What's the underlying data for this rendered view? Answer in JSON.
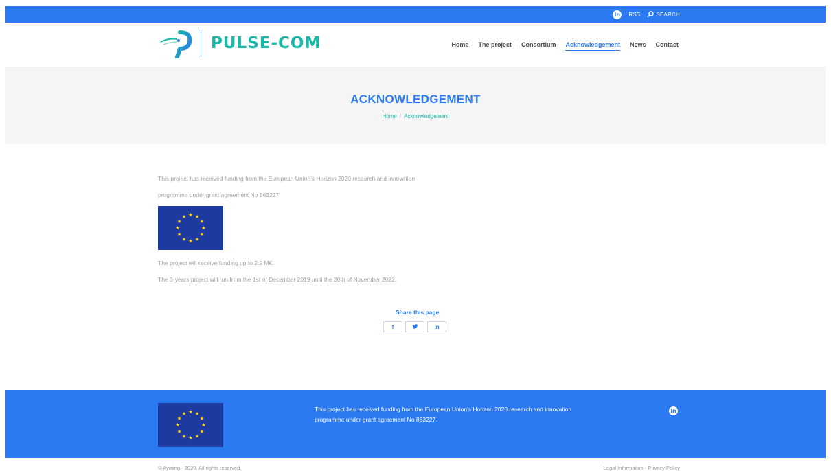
{
  "colors": {
    "primary": "#2b7af2",
    "teal": "#17b8a6",
    "text_muted": "#a3a3a3",
    "title_band": "#f5f5f5",
    "eu_blue": "#1d3aa0",
    "eu_star": "#ffd400"
  },
  "topbar": {
    "linkedin_glyph": "in",
    "rss_label": "RSS",
    "search_label": "SEARCH",
    "icons": [
      "linkedin-icon",
      "search-icon"
    ]
  },
  "header": {
    "logo_text": "PULSE-COM",
    "nav": [
      {
        "label": "Home"
      },
      {
        "label": "The project"
      },
      {
        "label": "Consortium"
      },
      {
        "label": "Acknowledgement",
        "active": true
      },
      {
        "label": "News"
      },
      {
        "label": "Contact"
      }
    ]
  },
  "titleband": {
    "title": "ACKNOWLEDGEMENT",
    "breadcrumb_home": "Home",
    "breadcrumb_sep": "/",
    "breadcrumb_current": "Acknowledgement"
  },
  "content": {
    "paragraph1": "This project has received funding from the European Union’s Horizon 2020 research and innovation",
    "paragraph2": "programme under grant agreement No 863227",
    "paragraph3": "The project will receive funding up to 2.9 M€.",
    "paragraph4": "The 3-years project will run from the 1st of December 2019 until the 30th of November 2022.",
    "share_title": "Share this page",
    "share_buttons": [
      {
        "glyph": "f",
        "icon": "facebook-icon"
      },
      {
        "glyph": "𝕥",
        "icon": "twitter-icon"
      },
      {
        "glyph": "in",
        "icon": "linkedin-icon"
      }
    ]
  },
  "footer": {
    "text": "This project has received funding from the European Union’s Horizon 2020 research and innovation programme under grant agreement No 863227.",
    "linkedin_glyph": "in",
    "copyright": "© Ayming - 2020. All rights reserved.",
    "legal_information": "Legal Information",
    "legal_sep": " - ",
    "privacy_policy": "Privacy Policy"
  }
}
